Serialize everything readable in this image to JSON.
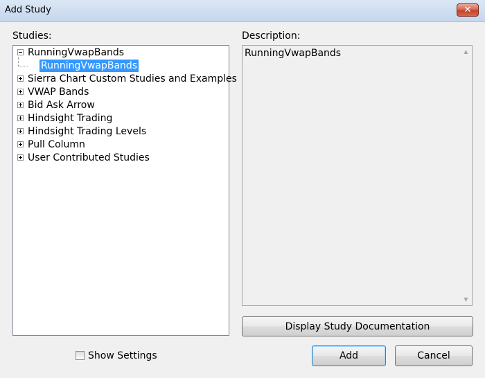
{
  "window": {
    "title": "Add Study",
    "close_icon": "close-icon"
  },
  "studies": {
    "label": "Studies:",
    "tree": [
      {
        "label": "RunningVwapBands",
        "expanded": true,
        "children": [
          {
            "label": "RunningVwapBands",
            "selected": true
          }
        ]
      },
      {
        "label": "Sierra Chart Custom Studies and Examples",
        "expanded": false
      },
      {
        "label": "VWAP Bands",
        "expanded": false
      },
      {
        "label": "Bid Ask Arrow",
        "expanded": false
      },
      {
        "label": "Hindsight Trading",
        "expanded": false
      },
      {
        "label": "Hindsight Trading Levels",
        "expanded": false
      },
      {
        "label": "Pull Column",
        "expanded": false
      },
      {
        "label": "User Contributed Studies",
        "expanded": false
      }
    ]
  },
  "description": {
    "label": "Description:",
    "text": "RunningVwapBands"
  },
  "buttons": {
    "documentation": "Display Study Documentation",
    "add": "Add",
    "cancel": "Cancel"
  },
  "show_settings": {
    "label": "Show Settings",
    "checked": false
  },
  "colors": {
    "selection": "#3399ff",
    "titlebar": "#c5d7ee",
    "close_button": "#c2422b"
  }
}
